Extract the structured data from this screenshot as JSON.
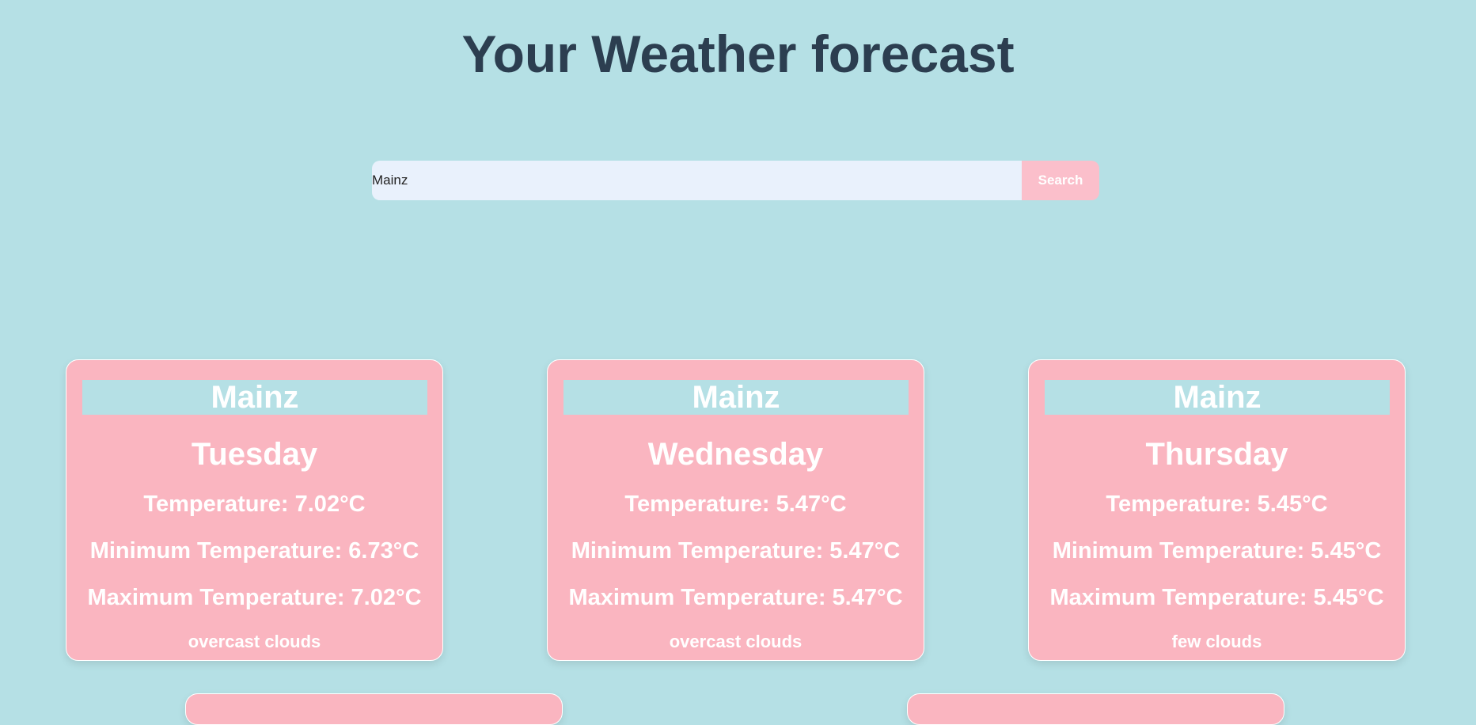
{
  "header": {
    "title": "Your Weather forecast"
  },
  "search": {
    "value": "Mainz",
    "button_label": "Search"
  },
  "forecasts": [
    {
      "city": "Mainz",
      "day": "Tuesday",
      "temperature": "Temperature: 7.02°C",
      "min_temperature": "Minimum Temperature: 6.73°C",
      "max_temperature": "Maximum Temperature: 7.02°C",
      "description": "overcast clouds"
    },
    {
      "city": "Mainz",
      "day": "Wednesday",
      "temperature": "Temperature: 5.47°C",
      "min_temperature": "Minimum Temperature: 5.47°C",
      "max_temperature": "Maximum Temperature: 5.47°C",
      "description": "overcast clouds"
    },
    {
      "city": "Mainz",
      "day": "Thursday",
      "temperature": "Temperature: 5.45°C",
      "min_temperature": "Minimum Temperature: 5.45°C",
      "max_temperature": "Maximum Temperature: 5.45°C",
      "description": "few clouds"
    }
  ],
  "colors": {
    "background": "#b5e0e5",
    "card": "#fab5c0",
    "title": "#2c3e50",
    "search_input": "#e9f1fc",
    "search_button": "#fbbfcb"
  }
}
